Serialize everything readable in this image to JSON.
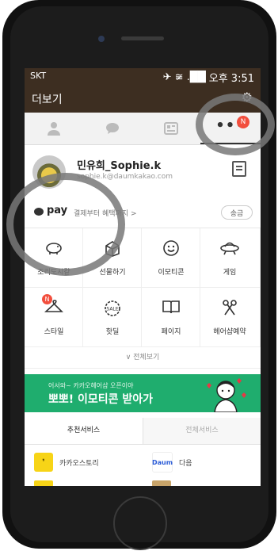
{
  "statusbar": {
    "carrier": "SKT",
    "icons": "✈ ≆ .██",
    "time": "오후 3:51"
  },
  "header": {
    "title": "더보기",
    "settings_icon": "gear-icon"
  },
  "tabs": [
    {
      "name": "friends",
      "icon": "person-icon"
    },
    {
      "name": "chats",
      "icon": "chat-bubble-icon"
    },
    {
      "name": "channel",
      "icon": "news-icon"
    },
    {
      "name": "more",
      "icon": "dots-icon",
      "badge": "N"
    }
  ],
  "profile": {
    "name": "민유희_Sophie.k",
    "email": "sophie.k@daumkakao.com"
  },
  "pay": {
    "brand": "pay",
    "desc": "결제부터 혜택까지 >",
    "button": "송금"
  },
  "grid": [
    {
      "label": "조리도시컅",
      "icon": "piggy-bank-icon",
      "badge": ""
    },
    {
      "label": "선물하기",
      "icon": "gift-box-icon",
      "badge": ""
    },
    {
      "label": "이모티콘",
      "icon": "smiley-icon",
      "badge": ""
    },
    {
      "label": "게임",
      "icon": "ufo-icon",
      "badge": ""
    },
    {
      "label": "스타일",
      "icon": "hanger-icon",
      "badge": "N"
    },
    {
      "label": "핫딜",
      "icon": "sale-tag-icon",
      "badge": ""
    },
    {
      "label": "페이지",
      "icon": "book-icon",
      "badge": ""
    },
    {
      "label": "헤어샵예약",
      "icon": "scissors-icon",
      "badge": ""
    }
  ],
  "more_link": "∨ 전체보기",
  "banner": {
    "small": "어서와~ 카카오헤어샵 오픈이야",
    "big": "뽀뽀! 이모티콘 받아가",
    "color": "#1fad6e"
  },
  "subtabs": [
    "추천서비스",
    "전체서비스"
  ],
  "services": [
    {
      "name": "카카오스토리",
      "logo": "❜",
      "color": "#f7d417"
    },
    {
      "name": "다음",
      "logo": "Daum",
      "color": "#ffffff"
    }
  ],
  "colors": {
    "header": "#3d2e21",
    "badge": "#f24e3d",
    "accent_green": "#1fad6e"
  }
}
